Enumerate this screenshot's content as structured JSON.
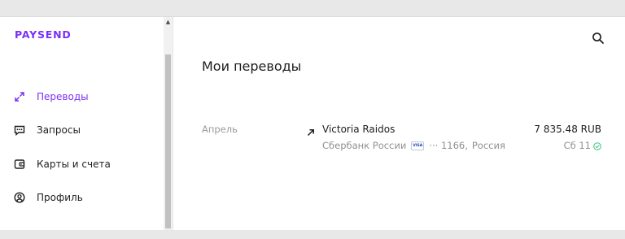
{
  "brand": {
    "logo_text": "PAYSEND",
    "accent": "#7b2ff7"
  },
  "sidebar": {
    "items": [
      {
        "label": "Переводы",
        "icon": "transfer-arrows-icon",
        "active": true
      },
      {
        "label": "Запросы",
        "icon": "chat-bubble-icon",
        "active": false
      },
      {
        "label": "Карты и счета",
        "icon": "wallet-icon",
        "active": false
      },
      {
        "label": "Профиль",
        "icon": "profile-icon",
        "active": false
      }
    ]
  },
  "header": {
    "search_icon": "search-icon"
  },
  "main": {
    "title": "Мои переводы",
    "groups": [
      {
        "month": "Апрель",
        "transactions": [
          {
            "direction_icon": "arrow-up-right-icon",
            "recipient": "Victoria Raidos",
            "bank": "Сбербанк России",
            "card_brand": "VISA",
            "card_mask": "··· 1166,",
            "country": "Россия",
            "amount": "7 835.48 RUB",
            "date": "Сб 11",
            "status_icon": "check-circle-icon",
            "status_color": "#3cc47c"
          }
        ]
      }
    ]
  }
}
